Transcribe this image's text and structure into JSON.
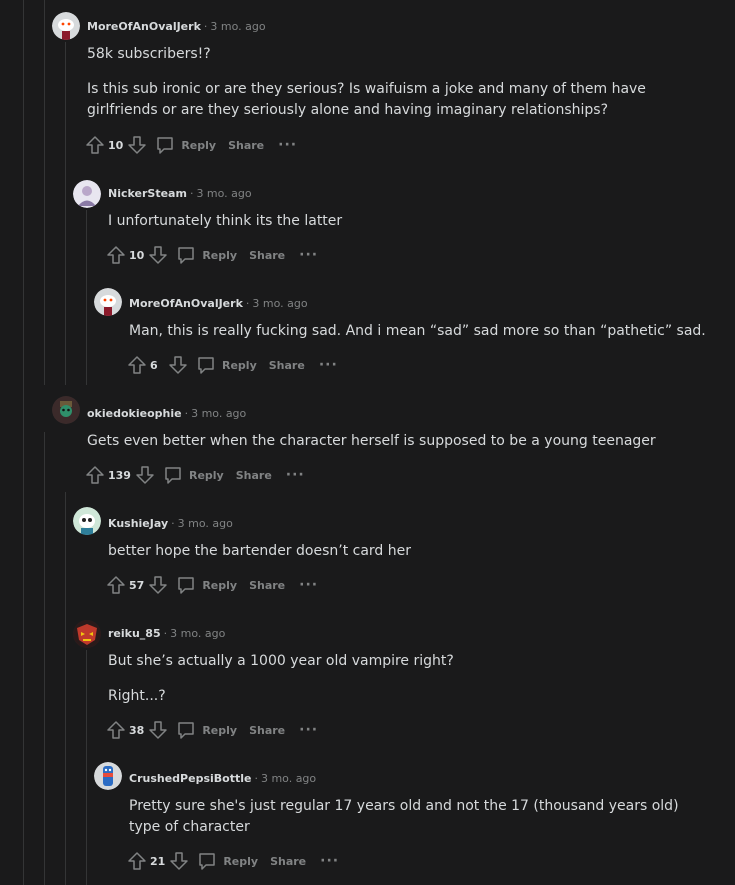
{
  "comments": [
    {
      "author": "MoreOfAnOvalJerk",
      "time": "3 mo. ago",
      "body": [
        "58k subscribers!?",
        "Is this sub ironic or are they serious? Is waifuism a joke and many of them have girlfriends or are they seriously alone and having imaginary relationships?"
      ],
      "score": "10"
    },
    {
      "author": "NickerSteam",
      "time": "3 mo. ago",
      "body": [
        "I unfortunately think its the latter"
      ],
      "score": "10"
    },
    {
      "author": "MoreOfAnOvalJerk",
      "time": "3 mo. ago",
      "body": [
        "Man, this is really fucking sad. And i mean “sad” sad more so than “pathetic” sad."
      ],
      "score": "6"
    },
    {
      "author": "okiedokieophie",
      "time": "3 mo. ago",
      "body": [
        "Gets even better when the character herself is supposed to be a young teenager"
      ],
      "score": "139"
    },
    {
      "author": "KushieJay",
      "time": "3 mo. ago",
      "body": [
        "better hope the bartender doesn’t card her"
      ],
      "score": "57"
    },
    {
      "author": "reiku_85",
      "time": "3 mo. ago",
      "body": [
        "But she’s actually a 1000 year old vampire right?",
        "Right...?"
      ],
      "score": "38"
    },
    {
      "author": "CrushedPepsiBottle",
      "time": "3 mo. ago",
      "body": [
        "Pretty sure she's just regular 17 years old and not the 17 (thousand years old) type of character"
      ],
      "score": "21"
    }
  ],
  "actions": {
    "reply": "Reply",
    "share": "Share",
    "more": "···"
  },
  "separator": "·",
  "colors": {
    "background": "#1a1a1b",
    "text": "#d7dadc",
    "muted": "#818384",
    "thread_line": "#343536"
  }
}
